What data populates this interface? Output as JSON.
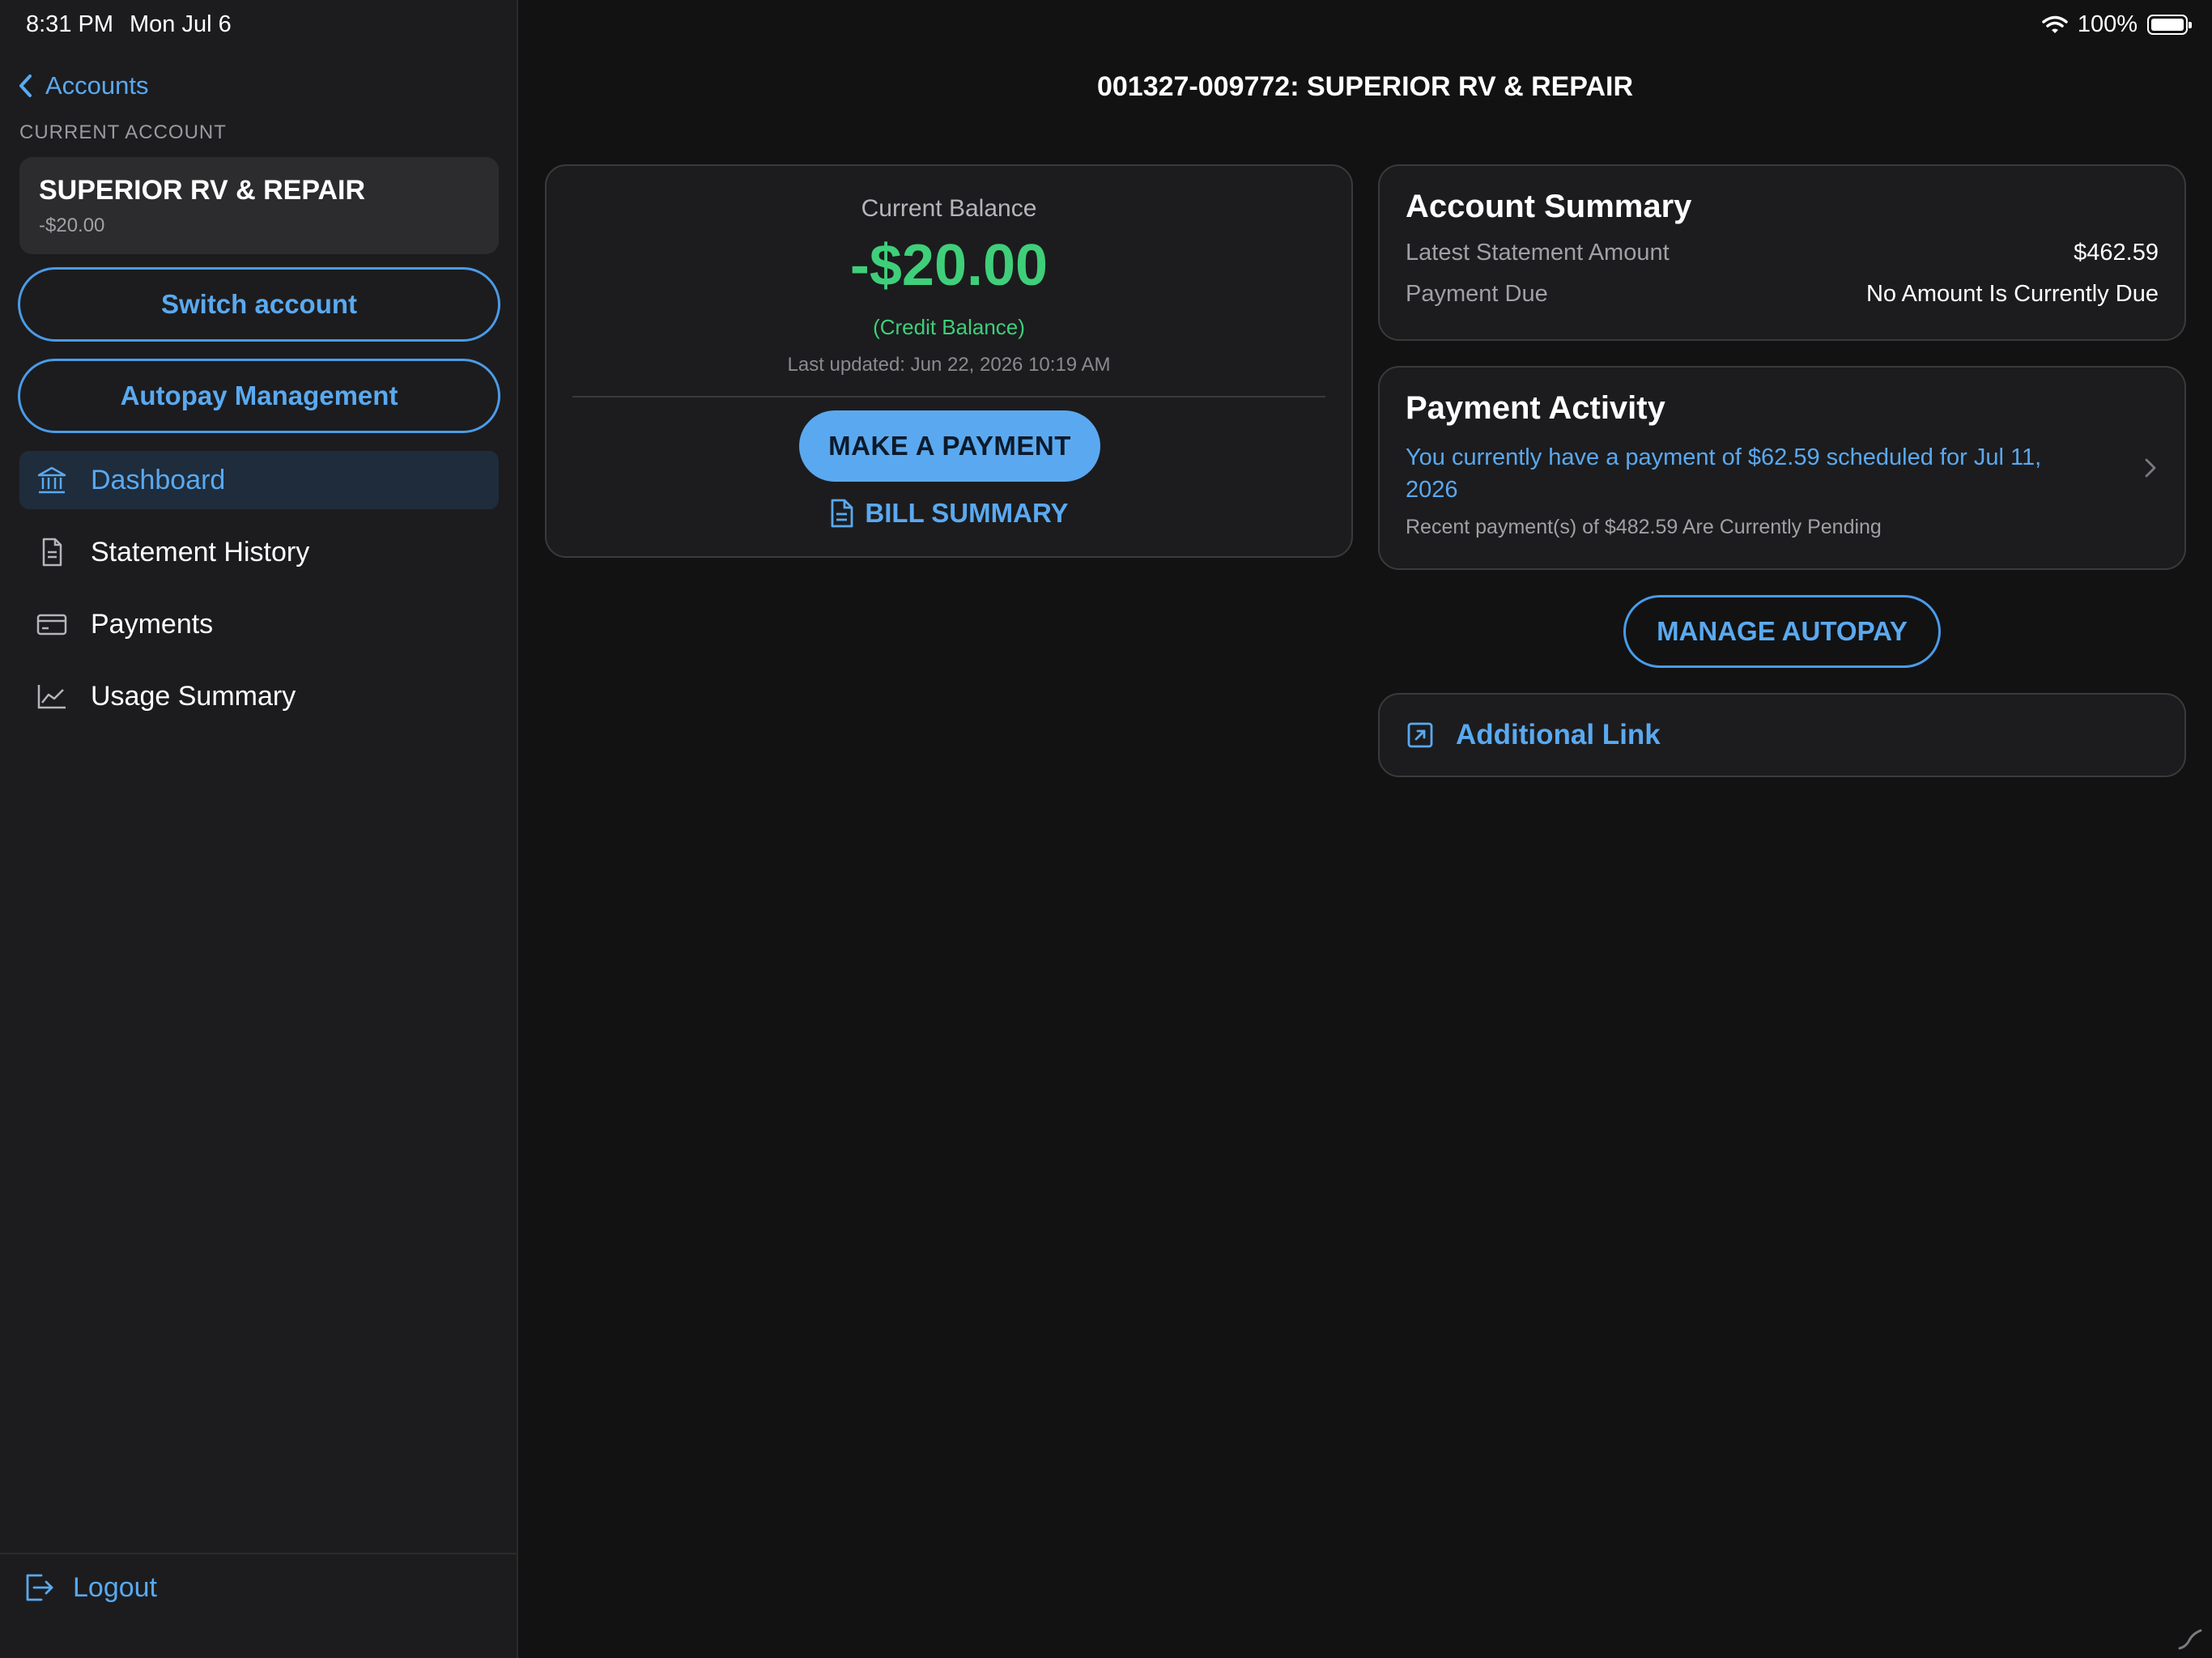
{
  "status_bar": {
    "time": "8:31 PM",
    "date": "Mon Jul 6",
    "battery": "100%"
  },
  "sidebar": {
    "back_label": "Accounts",
    "section_label": "CURRENT ACCOUNT",
    "account": {
      "name": "SUPERIOR RV & REPAIR",
      "balance": "-$20.00"
    },
    "switch_account_label": "Switch account",
    "autopay_management_label": "Autopay Management",
    "nav": [
      {
        "label": "Dashboard",
        "icon": "bank-icon",
        "active": true
      },
      {
        "label": "Statement History",
        "icon": "document-icon",
        "active": false
      },
      {
        "label": "Payments",
        "icon": "credit-card-icon",
        "active": false
      },
      {
        "label": "Usage Summary",
        "icon": "chart-line-icon",
        "active": false
      }
    ],
    "logout_label": "Logout"
  },
  "main": {
    "title": "001327-009772: SUPERIOR RV & REPAIR",
    "balance_card": {
      "label": "Current Balance",
      "amount": "-$20.00",
      "credit_note": "(Credit Balance)",
      "updated": "Last updated: Jun 22, 2026 10:19 AM",
      "pay_button": "MAKE A PAYMENT",
      "bill_summary": "BILL SUMMARY"
    },
    "account_summary": {
      "heading": "Account Summary",
      "latest_statement_label": "Latest Statement Amount",
      "latest_statement_value": "$462.59",
      "payment_due_label": "Payment Due",
      "payment_due_value": "No Amount Is Currently Due"
    },
    "payment_activity": {
      "heading": "Payment Activity",
      "scheduled": "You currently have a payment of $62.59 scheduled for Jul 11, 2026",
      "pending": "Recent payment(s) of $482.59 Are Currently Pending"
    },
    "manage_autopay": "MANAGE AUTOPAY",
    "additional_link": "Additional Link"
  },
  "colors": {
    "accent": "#5aa9f0",
    "positive": "#3fcf7a",
    "background": "#121212",
    "surface": "#1c1c1e"
  }
}
